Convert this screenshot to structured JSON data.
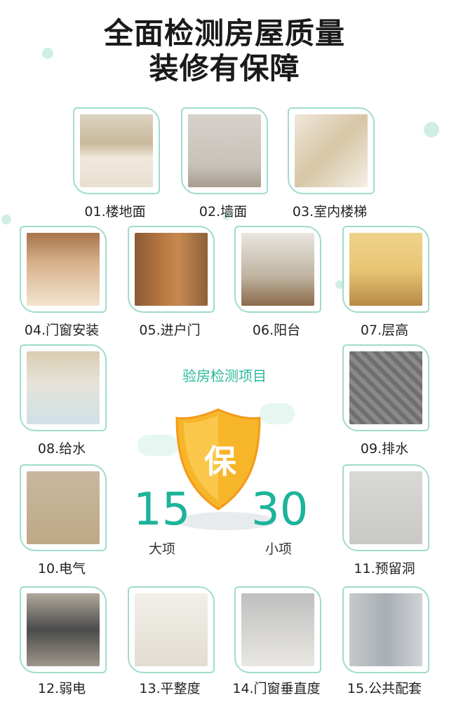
{
  "header": {
    "line1": "全面检测房屋质量",
    "line2": "装修有保障"
  },
  "items": [
    {
      "label": "01.楼地面"
    },
    {
      "label": "02.墙面"
    },
    {
      "label": "03.室内楼梯"
    },
    {
      "label": "04.门窗安装"
    },
    {
      "label": "05.进户门"
    },
    {
      "label": "06.阳台"
    },
    {
      "label": "07.层高"
    },
    {
      "label": "08.给水"
    },
    {
      "label": "09.排水"
    },
    {
      "label": "10.电气"
    },
    {
      "label": "11.预留洞"
    },
    {
      "label": "12.弱电"
    },
    {
      "label": "13.平整度"
    },
    {
      "label": "14.门窗垂直度"
    },
    {
      "label": "15.公共配套"
    }
  ],
  "center": {
    "subtitle": "验房检测项目",
    "shield_char": "保",
    "left_number": "15",
    "left_unit": "大项",
    "right_number": "30",
    "right_unit": "小项"
  },
  "colors": {
    "accent": "#1db39b",
    "card_border": "#9fdccb",
    "shield": "#f7b52a"
  }
}
